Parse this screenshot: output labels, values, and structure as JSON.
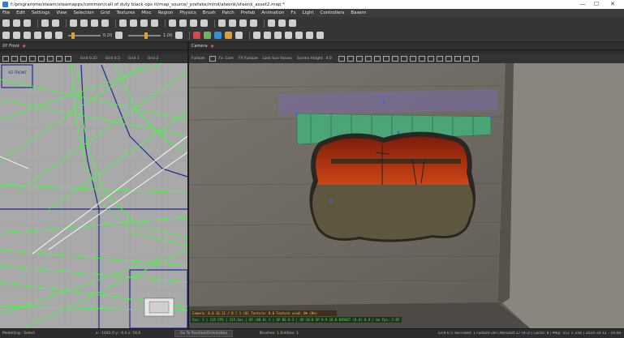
{
  "titlebar": {
    "path": "f:/programme/steam/steamapps/common/call of duty black ops iii/map_source/_prefabs/mind/ateenk/steenk_asset2.map *",
    "controls": [
      "—",
      "☐",
      "✕"
    ]
  },
  "menu": [
    "File",
    "Edit",
    "Settings",
    "View",
    "Selection",
    "Grid",
    "Textures",
    "Misc",
    "Region",
    "Physics",
    "Brush",
    "Patch",
    "Prefab",
    "Animation",
    "Fx",
    "Light",
    "Controllers",
    "Basern"
  ],
  "toolbar2": {
    "slider1_value": "0.20",
    "slider2_value": "1.00"
  },
  "xy_panel": {
    "tab": "XY Front",
    "toolbar_labels": [
      "Grid 0.25",
      "Grid 0.5",
      "Grid 1",
      "Grid 2"
    ],
    "corner_label": "XZ FRONT"
  },
  "camera_panel": {
    "tab": "Camera",
    "toolbar_labels": [
      "Fullsize",
      "Fx: Cam",
      "FX Fullsize",
      "Lock Sun Values",
      "Screen Height",
      "4.0"
    ],
    "overlay_line1": "Camera: 0.0 16.11 / 0 / 1 (0) Texture: 0.0 Texture used: 0% (0%)",
    "overlay_line2": "Fps: 1 | 135 FPS | 215.1ms | GP (68.0) 1 | GP BS 0.3 | GP 10.0 GP 9.9 10.0 BIRGET (0.0) 0.0 | ma fps: 2.05 / 4 ms"
  },
  "status": {
    "left": "Modelling : Select",
    "coords": "x: -1041.0  y: -0.0  z: 54.0",
    "button": "Go To Position/Orientation",
    "brushes": "Brushes: 1  Entities: 1",
    "right": "Grid 0.5 Tex:Fixed: 1 Fullsize:28 ChbrsDist:17 (0-2) | Locks: 8 | Map: 512 × 256 | 2024-10-12 - 19:48 · 123"
  },
  "colors": {
    "wire": "#39ff39",
    "grid_blue": "#1f2a8a",
    "sky": "#d24a1c",
    "wall": "#6e6a62"
  }
}
